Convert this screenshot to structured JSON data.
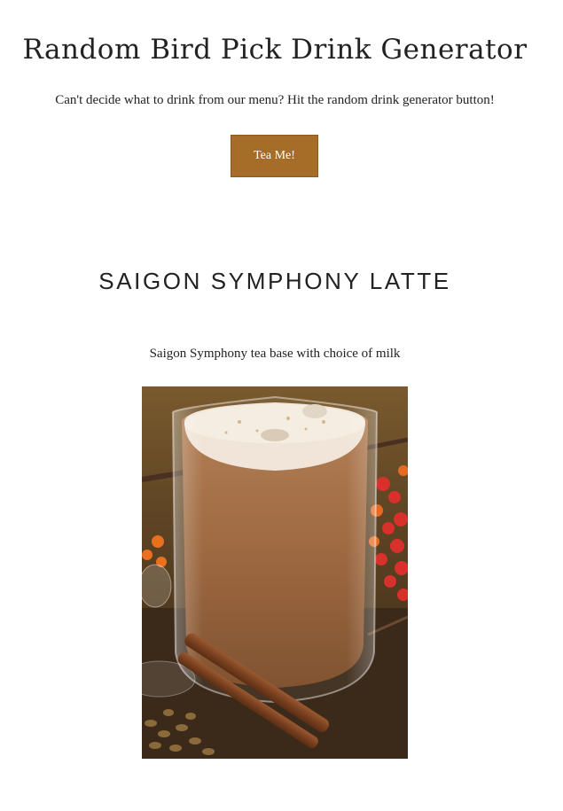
{
  "header": {
    "title": "Random Bird Pick Drink Generator",
    "intro": "Can't decide what to drink from our menu? Hit the random drink generator button!",
    "button_label": "Tea Me!"
  },
  "drink": {
    "name": "SAIGON SYMPHONY LATTE",
    "description": "Saigon Symphony tea base with choice of milk",
    "image": "latte-photo"
  },
  "colors": {
    "button": "#a56d27",
    "text": "#222222",
    "background": "#ffffff"
  }
}
